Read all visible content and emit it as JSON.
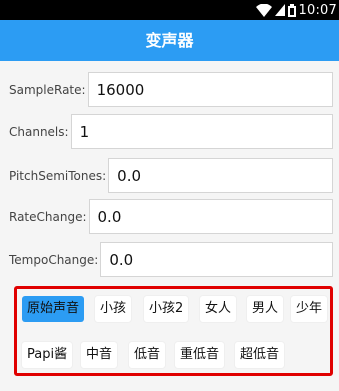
{
  "status_bar": {
    "time": "10:07"
  },
  "app_bar": {
    "title": "变声器"
  },
  "fields": [
    {
      "label": "SampleRate:",
      "value": "16000"
    },
    {
      "label": "Channels:",
      "value": "1"
    },
    {
      "label": "PitchSemiTones:",
      "value": "0.0"
    },
    {
      "label": "RateChange:",
      "value": "0.0"
    },
    {
      "label": "TempoChange:",
      "value": "0.0"
    }
  ],
  "effects": [
    {
      "label": "原始声音",
      "selected": true
    },
    {
      "label": "小孩",
      "selected": false
    },
    {
      "label": "小孩2",
      "selected": false
    },
    {
      "label": "女人",
      "selected": false
    },
    {
      "label": "男人",
      "selected": false
    },
    {
      "label": "少年",
      "selected": false
    },
    {
      "label": "Papi酱",
      "selected": false
    },
    {
      "label": "中音",
      "selected": false
    },
    {
      "label": "低音",
      "selected": false
    },
    {
      "label": "重低音",
      "selected": false
    },
    {
      "label": "超低音",
      "selected": false
    }
  ],
  "colors": {
    "accent": "#2c9cf3",
    "highlight_border": "#e00000"
  }
}
